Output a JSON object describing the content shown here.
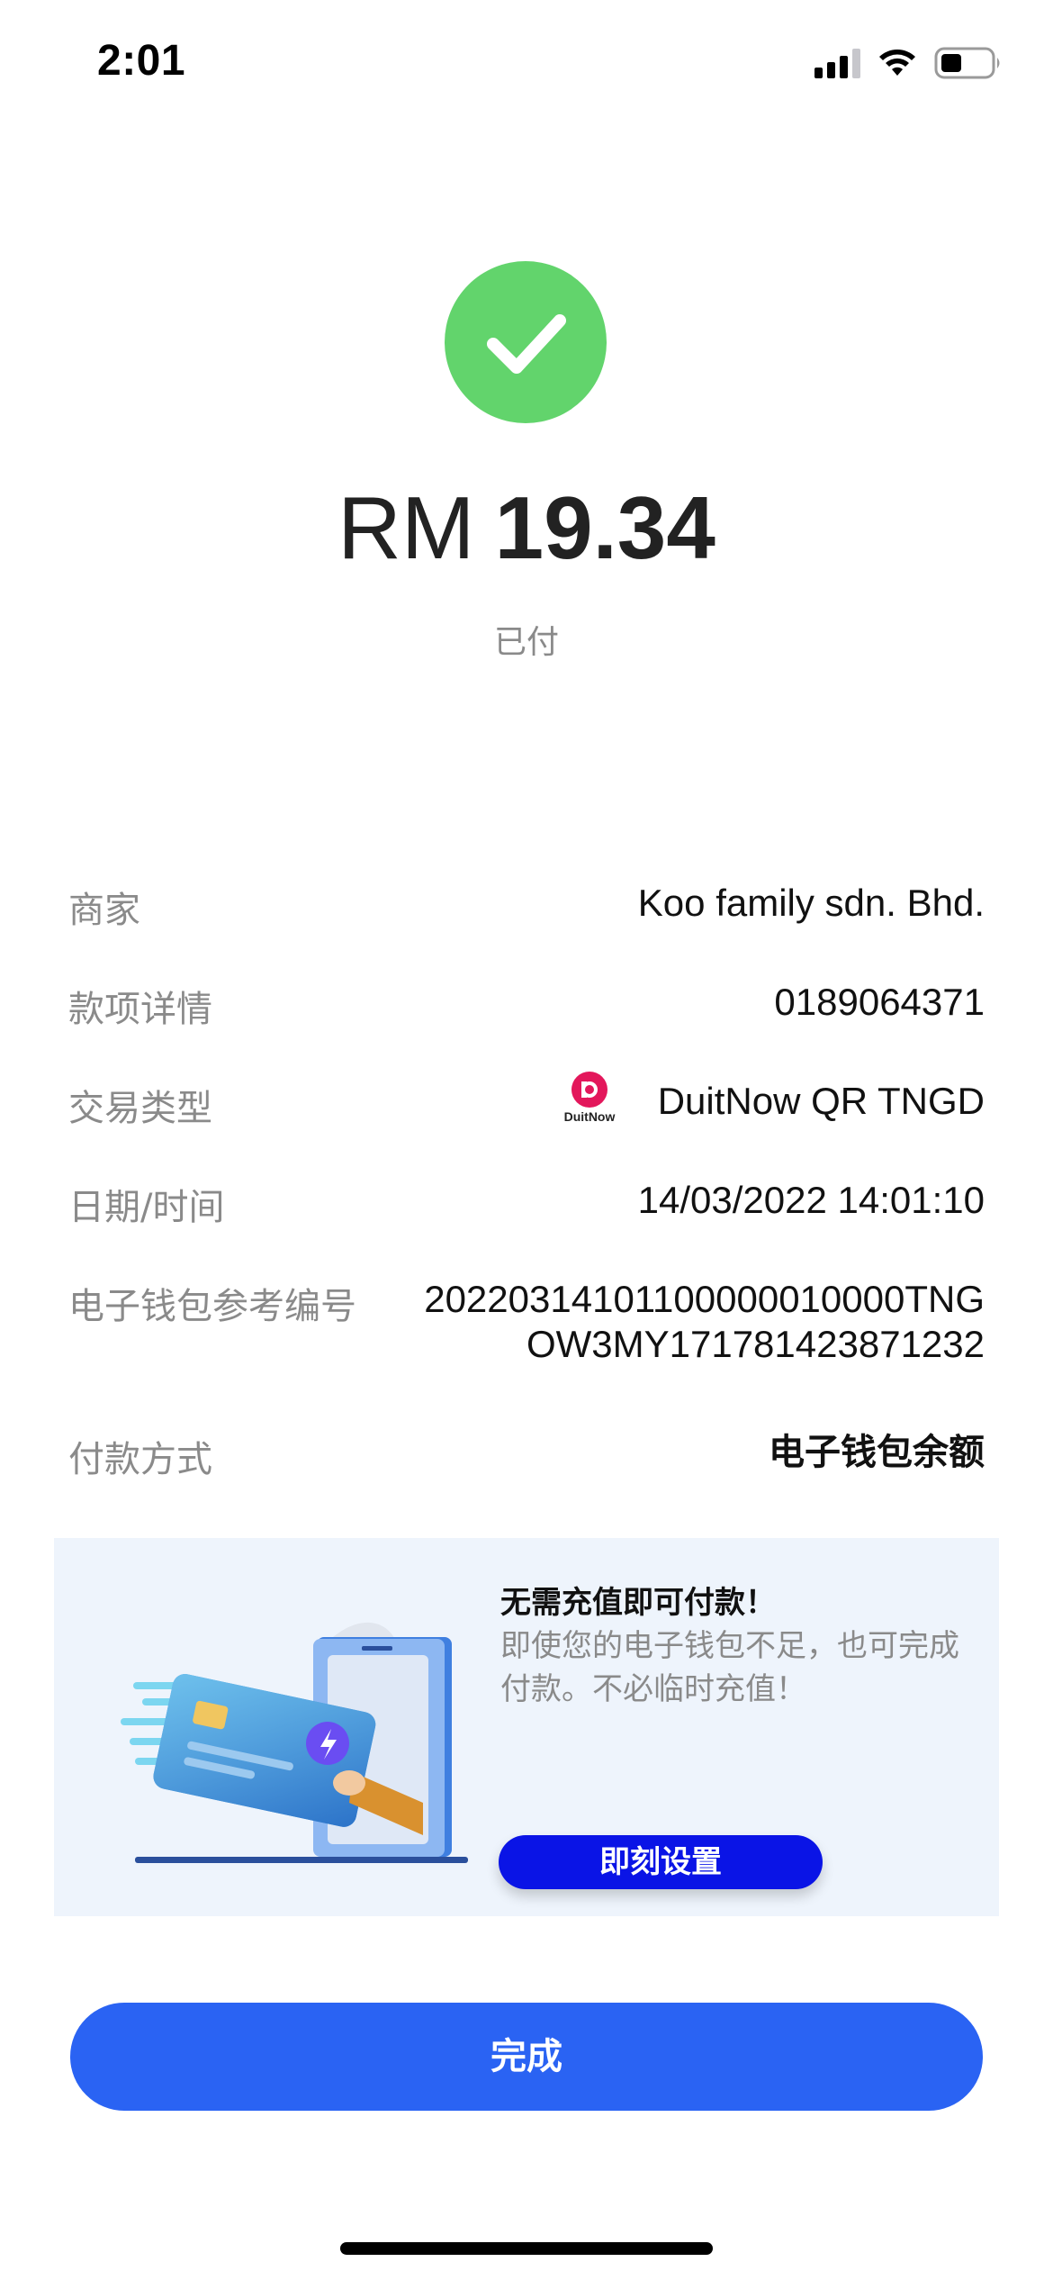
{
  "status_bar": {
    "time": "2:01",
    "icons": [
      "cellular-signal-icon",
      "wifi-icon",
      "battery-icon"
    ]
  },
  "payment": {
    "currency": "RM",
    "amount": "19.34",
    "status": "已付",
    "status_icon": "checkmark-icon",
    "status_color": "#62d46c"
  },
  "details": {
    "merchant": {
      "label": "商家",
      "value": "Koo family sdn. Bhd."
    },
    "payment_details": {
      "label": "款项详情",
      "value": "0189064371"
    },
    "transaction_type": {
      "label": "交易类型",
      "value": "DuitNow QR TNGD",
      "logo_text": "DuitNow"
    },
    "datetime": {
      "label": "日期/时间",
      "value": "14/03/2022 14:01:10"
    },
    "reference": {
      "label": "电子钱包参考编号",
      "value_line1": "20220314101100000010000TNG",
      "value_line2": "OW3MY171781423871232"
    },
    "payment_method": {
      "label": "付款方式",
      "value": "电子钱包余额"
    }
  },
  "promo": {
    "title": "无需充值即可付款！",
    "description": "即使您的电子钱包不足，也可完成付款。不必临时充值！",
    "button_label": "即刻设置",
    "button_color": "#0a14e6"
  },
  "done_button": {
    "label": "完成",
    "color": "#2a63f3"
  }
}
